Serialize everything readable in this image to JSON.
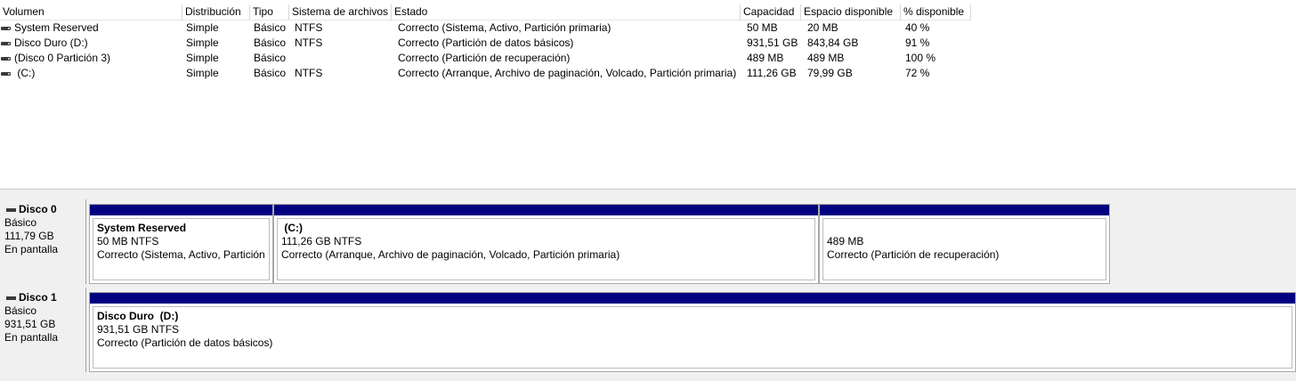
{
  "columns": [
    "Volumen",
    "Distribución",
    "Tipo",
    "Sistema de archivos",
    "Estado",
    "Capacidad",
    "Espacio disponible",
    "% disponible"
  ],
  "volumes": [
    {
      "volume": "System Reserved",
      "layout": "Simple",
      "type": "Básico",
      "fs": "NTFS",
      "status": "Correcto (Sistema, Activo, Partición primaria)",
      "capacity": "50 MB",
      "free": "20 MB",
      "pct": "40 %"
    },
    {
      "volume": "Disco Duro (D:)",
      "layout": "Simple",
      "type": "Básico",
      "fs": "NTFS",
      "status": "Correcto (Partición de datos básicos)",
      "capacity": "931,51 GB",
      "free": "843,84 GB",
      "pct": "91 %"
    },
    {
      "volume": "(Disco 0 Partición 3)",
      "layout": "Simple",
      "type": "Básico",
      "fs": "",
      "status": "Correcto (Partición de recuperación)",
      "capacity": "489 MB",
      "free": "489 MB",
      "pct": "100 %"
    },
    {
      "volume": " (C:)",
      "layout": "Simple",
      "type": "Básico",
      "fs": "NTFS",
      "status": "Correcto (Arranque, Archivo de paginación, Volcado, Partición primaria)",
      "capacity": "111,26 GB",
      "free": "79,99 GB",
      "pct": "72 %"
    }
  ],
  "disks": [
    {
      "name": "Disco 0",
      "kind": "Básico",
      "size": "111,79 GB",
      "state": "En pantalla",
      "partitions": [
        {
          "title": "System Reserved",
          "size_fs": "50 MB NTFS",
          "status": "Correcto (Sistema, Activo, Partición"
        },
        {
          "title": " (C:)",
          "size_fs": "111,26 GB NTFS",
          "status": "Correcto (Arranque, Archivo de paginación, Volcado, Partición primaria)"
        },
        {
          "title": "",
          "size_fs": "489 MB",
          "status": "Correcto (Partición de recuperación)"
        }
      ]
    },
    {
      "name": "Disco 1",
      "kind": "Básico",
      "size": "931,51 GB",
      "state": "En pantalla",
      "partitions": [
        {
          "title": "Disco Duro  (D:)",
          "size_fs": "931,51 GB NTFS",
          "status": "Correcto (Partición de datos básicos)"
        }
      ]
    }
  ],
  "colors": {
    "primary_partition_bar": "#000080"
  },
  "icons": {
    "volume": "drive-icon",
    "disk": "disk-icon"
  }
}
